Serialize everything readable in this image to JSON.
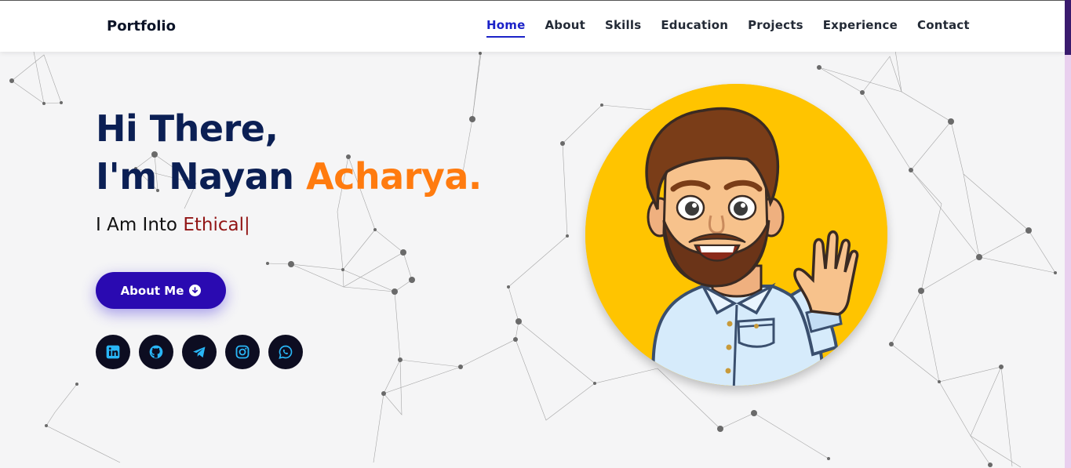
{
  "nav": {
    "brand": "Portfolio",
    "links": [
      "Home",
      "About",
      "Skills",
      "Education",
      "Projects",
      "Experience",
      "Contact"
    ],
    "active": "Home"
  },
  "hero": {
    "greeting": "Hi There,",
    "name_prefix": "I'm Nayan ",
    "name_highlight": "Acharya.",
    "typing_prefix": "I Am Into ",
    "typing_word": "Ethical",
    "typing_cursor": "|",
    "about_button": "About Me",
    "about_button_icon": "arrow-down-circle-icon"
  },
  "socials": [
    "linkedin-icon",
    "github-icon",
    "telegram-icon",
    "instagram-icon",
    "whatsapp-icon"
  ],
  "colors": {
    "navy": "#0b1f54",
    "orange": "#ff7b0f",
    "dark_red": "#921515",
    "button_purple": "#2a0ab1",
    "nav_active": "#1b22c8",
    "avatar_bg": "#ffc400",
    "social_icon": "#29b6f6"
  }
}
